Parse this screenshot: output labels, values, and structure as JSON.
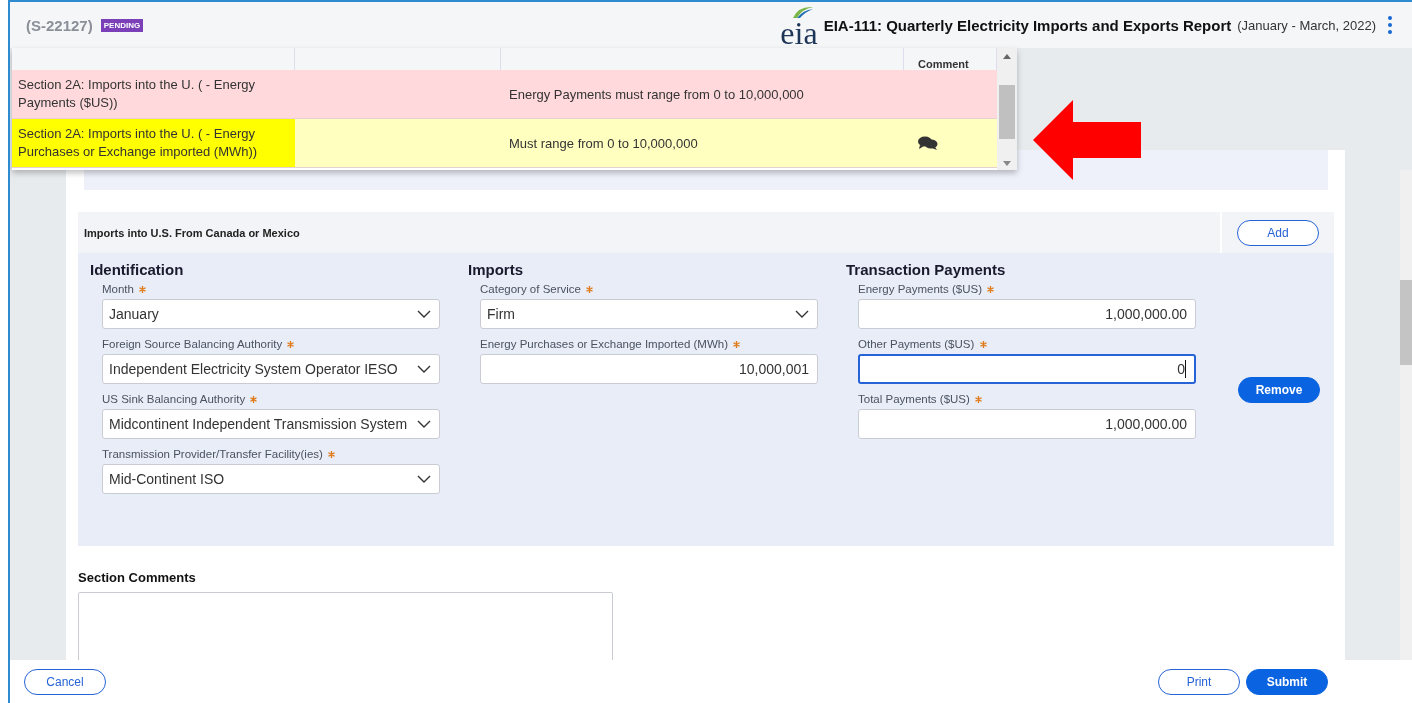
{
  "header": {
    "case_id": "(S-22127)",
    "status": "PENDING",
    "logo": "eia",
    "title": "EIA-111: Quarterly Electricity Imports and Exports Report",
    "period": "(January - March, 2022)"
  },
  "validation_popup": {
    "comment_header": "Comment",
    "rows": [
      {
        "kind": "error",
        "selected": false,
        "field": "Section 2A: Imports into the U. ( - Energy Payments ($US))",
        "message": "Energy Payments must range from 0 to 10,000,000",
        "has_comment": false
      },
      {
        "kind": "warning",
        "selected": true,
        "field": "Section 2A: Imports into the U. ( - Energy Purchases or Exchange imported (MWh))",
        "message": "Must range from 0 to 10,000,000",
        "has_comment": true
      }
    ]
  },
  "annotation": {
    "kind": "arrow",
    "color": "#ff0000"
  },
  "section": {
    "title": "Imports into U.S. From Canada or Mexico",
    "add_button": "Add",
    "remove_button": "Remove",
    "groups": [
      {
        "title": "Identification",
        "fields": [
          {
            "kind": "select",
            "label": "Month",
            "required": true,
            "value": "January",
            "focused": false
          },
          {
            "kind": "select",
            "label": "Foreign Source Balancing Authority",
            "required": true,
            "value": "Independent Electricity System Operator IESO",
            "focused": false
          },
          {
            "kind": "select",
            "label": "US Sink Balancing Authority",
            "required": true,
            "value": "Midcontinent Independent Transmission System ",
            "focused": false
          },
          {
            "kind": "select",
            "label": "Transmission Provider/Transfer Facility(ies)",
            "required": true,
            "value": "Mid-Continent ISO",
            "focused": false
          }
        ]
      },
      {
        "title": "Imports",
        "fields": [
          {
            "kind": "select",
            "label": "Category of Service",
            "required": true,
            "value": "Firm",
            "focused": false
          },
          {
            "kind": "number",
            "label": "Energy Purchases or Exchange Imported (MWh)",
            "required": true,
            "value": "10,000,001",
            "focused": false
          }
        ]
      },
      {
        "title": "Transaction Payments",
        "fields": [
          {
            "kind": "number",
            "label": "Energy Payments ($US)",
            "required": true,
            "value": "1,000,000.00",
            "focused": false
          },
          {
            "kind": "number",
            "label": "Other Payments ($US)",
            "required": true,
            "value": "0",
            "focused": true
          },
          {
            "kind": "number",
            "label": "Total Payments ($US)",
            "required": true,
            "value": "1,000,000.00",
            "focused": false
          }
        ]
      }
    ]
  },
  "comments": {
    "label": "Section Comments"
  },
  "footer": {
    "buttons": [
      {
        "kind": "secondary",
        "label": "Cancel"
      },
      {
        "kind": "secondary",
        "label": "Print"
      },
      {
        "kind": "primary",
        "label": "Submit"
      }
    ]
  }
}
